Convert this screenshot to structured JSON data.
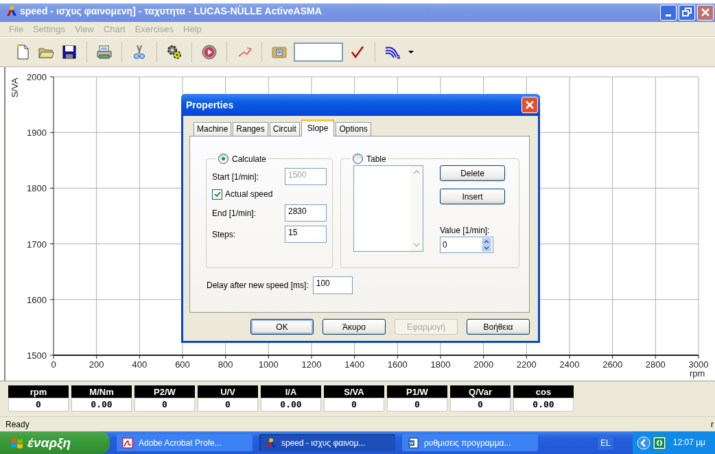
{
  "window": {
    "title": "speed - ισχυς φαινομενη] - ταχυτητα - LUCAS-NÜLLE ActiveASMA"
  },
  "menu": [
    "File",
    "Settings",
    "View",
    "Chart",
    "Exercises",
    "Help"
  ],
  "chart": {
    "chart_data": {
      "type": "line",
      "xlabel": "rpm",
      "ylabel": "S/VA",
      "xlim": [
        0,
        3000
      ],
      "ylim": [
        1500,
        2000
      ],
      "xticks": [
        0,
        200,
        400,
        600,
        800,
        1000,
        1200,
        1400,
        1600,
        1800,
        2000,
        2200,
        2400,
        2600,
        2800,
        3000
      ],
      "yticks": [
        1500,
        1600,
        1700,
        1800,
        1900,
        2000
      ],
      "grid": true
    }
  },
  "meters": [
    {
      "label": "rpm",
      "value": "0"
    },
    {
      "label": "M/Nm",
      "value": "0.00"
    },
    {
      "label": "P2/W",
      "value": "0"
    },
    {
      "label": "U/V",
      "value": "0"
    },
    {
      "label": "I/A",
      "value": "0.00"
    },
    {
      "label": "S/VA",
      "value": "0"
    },
    {
      "label": "P1/W",
      "value": "0"
    },
    {
      "label": "Q/Var",
      "value": "0"
    },
    {
      "label": "cos",
      "value": "0.00"
    }
  ],
  "status_bar": {
    "text": "Ready",
    "right_text": "r"
  },
  "dialog": {
    "title": "Properties",
    "tabs": [
      {
        "label": "Machine",
        "selected": false
      },
      {
        "label": "Ranges",
        "selected": false
      },
      {
        "label": "Circuit",
        "selected": false
      },
      {
        "label": "Slope",
        "selected": true
      },
      {
        "label": "Options",
        "selected": false
      }
    ],
    "calculate": {
      "label": "Calculate",
      "selected": true,
      "rows": [
        {
          "kind": "field",
          "label": "Start [1/min]:",
          "value": "1500",
          "disabled": true
        },
        {
          "kind": "checkbox",
          "label": "Actual speed",
          "checked": true
        },
        {
          "kind": "field",
          "label": "End [1/min]:",
          "value": "2830",
          "disabled": false
        },
        {
          "kind": "field",
          "label": "Steps:",
          "value": "15",
          "disabled": false
        }
      ]
    },
    "table": {
      "label": "Table",
      "selected": false,
      "delete_button": "Delete",
      "insert_button": "Insert",
      "value_label": "Value [1/min]:",
      "value": "0"
    },
    "delay": {
      "label": "Delay after new speed [ms]:",
      "value": "100"
    },
    "buttons": [
      {
        "label": "OK",
        "default": true,
        "disabled": false
      },
      {
        "label": "Άκυρο",
        "default": false,
        "disabled": false
      },
      {
        "label": "Εφαρμογή",
        "default": false,
        "disabled": true
      },
      {
        "label": "Βοήθεια",
        "default": false,
        "disabled": false
      }
    ]
  },
  "taskbar": {
    "start": "έναρξη",
    "tasks": [
      {
        "label": "Adobe Acrobat Profe...",
        "kind": "acrobat",
        "selected": false
      },
      {
        "label": "speed - ισχυς φαινομ...",
        "kind": "app",
        "selected": true
      },
      {
        "label": "ρυθμισεις προγραμμα...",
        "kind": "doc",
        "selected": false
      }
    ],
    "language": "EL",
    "clock": "12:07 μμ"
  }
}
